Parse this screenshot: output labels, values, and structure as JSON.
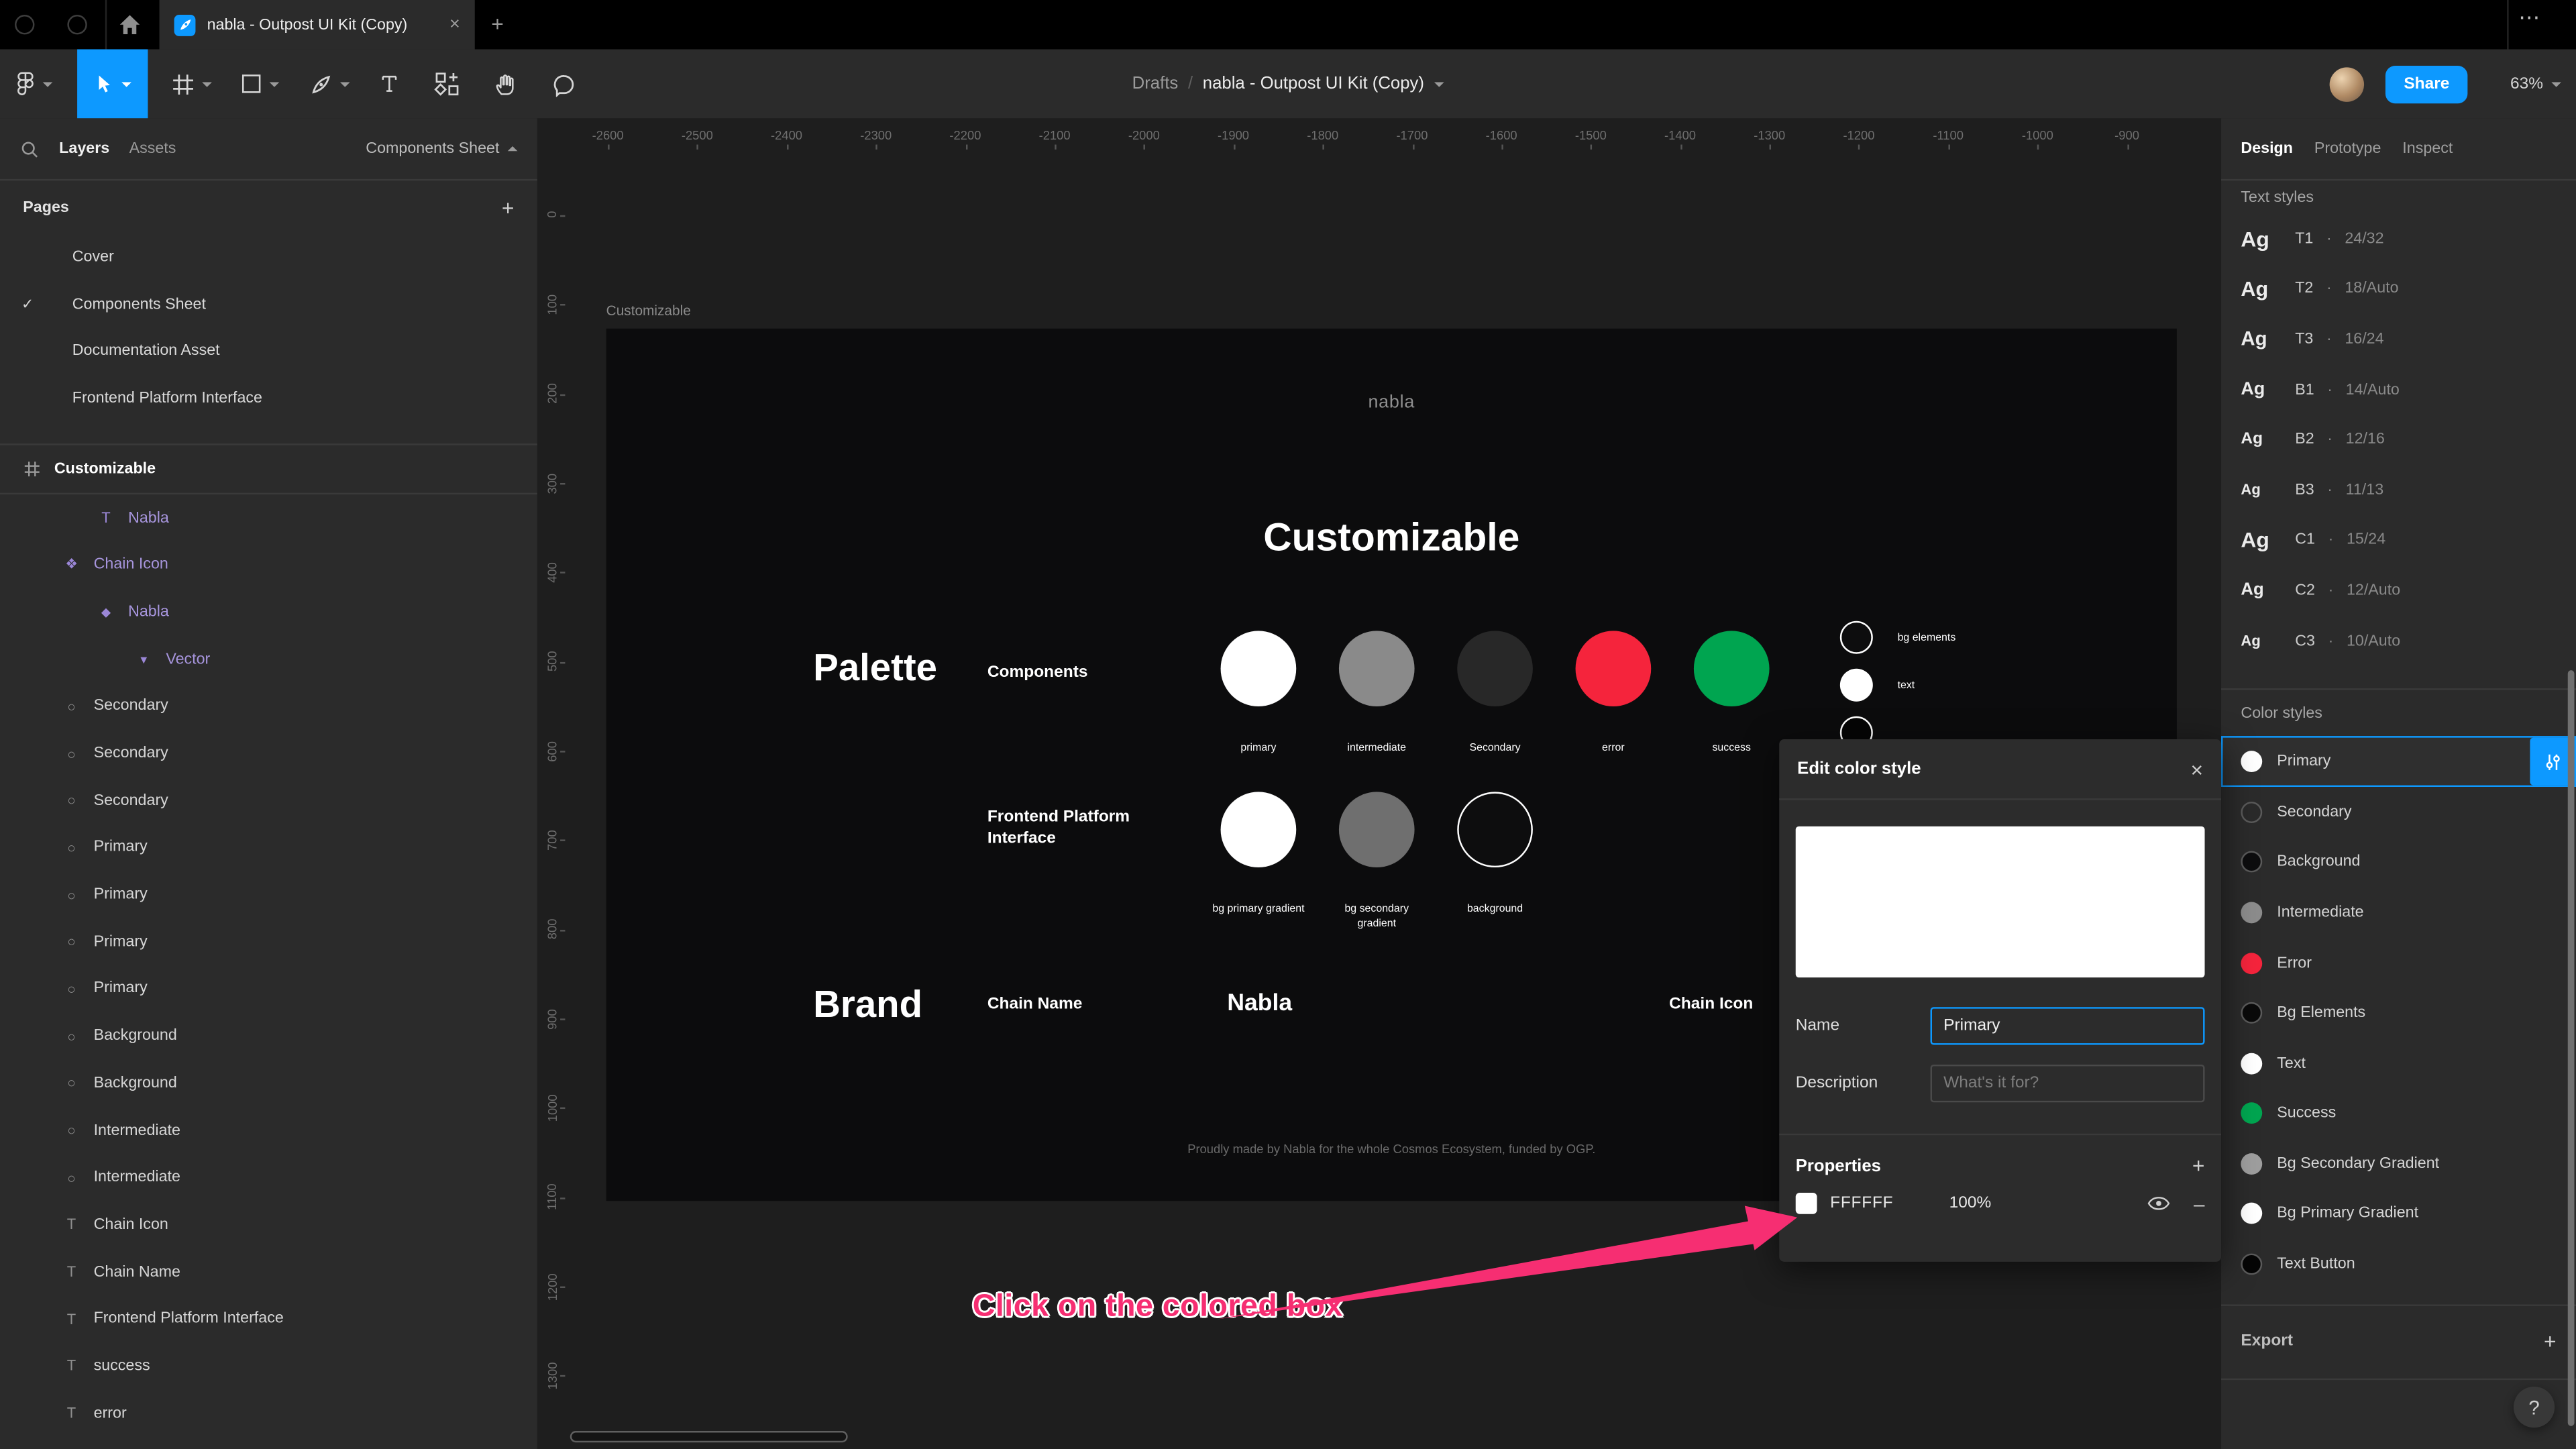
{
  "icons": {
    "close": "×",
    "plus": "+",
    "minus": "–",
    "check": "✓",
    "more": "⋯",
    "middot": "·",
    "help": "?",
    "newtab": "+"
  },
  "topbar": {
    "tab_title": "nabla - Outpost UI Kit (Copy)"
  },
  "toolbar": {
    "breadcrumb_root": "Drafts",
    "breadcrumb_sep": "/",
    "file_name": "nabla - Outpost UI Kit (Copy)",
    "share_label": "Share",
    "zoom_level": "63%"
  },
  "left_sidebar": {
    "layers_tab": "Layers",
    "assets_tab": "Assets",
    "page_selector": "Components Sheet",
    "pages_header": "Pages",
    "pages": [
      {
        "label": "Cover",
        "check": ""
      },
      {
        "label": "Components Sheet",
        "check": "✓"
      },
      {
        "label": "Documentation Asset",
        "check": ""
      },
      {
        "label": "Frontend Platform Interface",
        "check": ""
      }
    ],
    "frame_name": "Customizable",
    "layers": [
      {
        "glyph": "T",
        "label": "Nabla",
        "tone": "purple",
        "pad": "57px",
        "gsize": "9px"
      },
      {
        "glyph": "❖",
        "label": "Chain Icon",
        "tone": "purple",
        "pad": "36px",
        "gsize": "8.5px"
      },
      {
        "glyph": "◆",
        "label": "Nabla",
        "tone": "purple",
        "pad": "57px",
        "gsize": "7.5px"
      },
      {
        "glyph": "▾",
        "label": "Vector",
        "tone": "purple",
        "pad": "80px",
        "gsize": "8px"
      },
      {
        "glyph": "○",
        "label": "Secondary",
        "tone": "",
        "pad": "36px",
        "gsize": "8.5px"
      },
      {
        "glyph": "○",
        "label": "Secondary",
        "tone": "",
        "pad": "36px",
        "gsize": "8.5px"
      },
      {
        "glyph": "○",
        "label": "Secondary",
        "tone": "",
        "pad": "36px",
        "gsize": "8.5px"
      },
      {
        "glyph": "○",
        "label": "Primary",
        "tone": "",
        "pad": "36px",
        "gsize": "8.5px"
      },
      {
        "glyph": "○",
        "label": "Primary",
        "tone": "",
        "pad": "36px",
        "gsize": "8.5px"
      },
      {
        "glyph": "○",
        "label": "Primary",
        "tone": "",
        "pad": "36px",
        "gsize": "8.5px"
      },
      {
        "glyph": "○",
        "label": "Primary",
        "tone": "",
        "pad": "36px",
        "gsize": "8.5px"
      },
      {
        "glyph": "○",
        "label": "Background",
        "tone": "",
        "pad": "36px",
        "gsize": "8.5px"
      },
      {
        "glyph": "○",
        "label": "Background",
        "tone": "",
        "pad": "36px",
        "gsize": "8.5px"
      },
      {
        "glyph": "○",
        "label": "Intermediate",
        "tone": "",
        "pad": "36px",
        "gsize": "8.5px"
      },
      {
        "glyph": "○",
        "label": "Intermediate",
        "tone": "",
        "pad": "36px",
        "gsize": "8.5px"
      },
      {
        "glyph": "T",
        "label": "Chain Icon",
        "tone": "",
        "pad": "36px",
        "gsize": "9px"
      },
      {
        "glyph": "T",
        "label": "Chain Name",
        "tone": "",
        "pad": "36px",
        "gsize": "9px"
      },
      {
        "glyph": "T",
        "label": "Frontend Platform Interface",
        "tone": "",
        "pad": "36px",
        "gsize": "9px"
      },
      {
        "glyph": "T",
        "label": "success",
        "tone": "",
        "pad": "36px",
        "gsize": "9px"
      },
      {
        "glyph": "T",
        "label": "error",
        "tone": "",
        "pad": "36px",
        "gsize": "9px"
      }
    ]
  },
  "canvas": {
    "frame_label": "Customizable",
    "logo": "nabla",
    "title": "Customizable",
    "h_ruler": [
      "-2600",
      "-2500",
      "-2400",
      "-2300",
      "-2200",
      "-2100",
      "-2000",
      "-1900",
      "-1800",
      "-1700",
      "-1600",
      "-1500",
      "-1400",
      "-1300",
      "-1200",
      "-1100",
      "-1000",
      "-900"
    ],
    "v_ruler": [
      "0",
      "100",
      "200",
      "300",
      "400",
      "500",
      "600",
      "700",
      "800",
      "900",
      "1000",
      "1100",
      "1200",
      "1300"
    ],
    "palette": {
      "title": "Palette",
      "subtitle": "Components",
      "swatches": [
        {
          "label": "primary",
          "color": "#FFFFFF",
          "cls": ""
        },
        {
          "label": "intermediate",
          "color": "#8A8A8A",
          "cls": ""
        },
        {
          "label": "Secondary",
          "color": "#282828",
          "cls": ""
        },
        {
          "label": "error",
          "color": "#F5243C",
          "cls": ""
        },
        {
          "label": "success",
          "color": "#00A550",
          "cls": ""
        }
      ]
    },
    "side_swatches": [
      {
        "label": "bg elements",
        "color": "#0D0D0E",
        "cls": "wring"
      },
      {
        "label": "text",
        "color": "#FFFFFF",
        "cls": ""
      },
      {
        "label": "",
        "color": "#050505",
        "cls": "wring"
      }
    ],
    "fpi": {
      "title": "Frontend Platform Interface",
      "swatches": [
        {
          "label": "bg primary gradient",
          "color": "#FFFFFF",
          "cls": ""
        },
        {
          "label": "bg secondary gradient",
          "color": "#6F6F6F",
          "cls": ""
        },
        {
          "label": "background",
          "color": "#0D0D0E",
          "cls": "wring"
        }
      ]
    },
    "brand": {
      "title": "Brand",
      "name_label": "Chain Name",
      "name_value": "Nabla",
      "icon_label": "Chain Icon"
    },
    "footer": "Proudly made by Nabla for the whole Cosmos Ecosystem, funded by OGP."
  },
  "dialog": {
    "title": "Edit color style",
    "name_label": "Name",
    "name_value": "Primary",
    "description_label": "Description",
    "description_placeholder": "What's it for?",
    "properties_label": "Properties",
    "hex": "FFFFFF",
    "opacity": "100%"
  },
  "annotation": {
    "text": "Click on the colored box",
    "color": "#F62E72"
  },
  "right_sidebar": {
    "tabs": [
      {
        "label": "Design",
        "cls": "active"
      },
      {
        "label": "Prototype",
        "cls": ""
      },
      {
        "label": "Inspect",
        "cls": ""
      }
    ],
    "text_styles_header": "Text styles",
    "sample": "Ag",
    "text_styles": [
      {
        "name": "T1",
        "value": "24/32",
        "size": "13px",
        "weight": "700"
      },
      {
        "name": "T2",
        "value": "18/Auto",
        "size": "12.5px",
        "weight": "700"
      },
      {
        "name": "T3",
        "value": "16/24",
        "size": "12px",
        "weight": "700"
      },
      {
        "name": "B1",
        "value": "14/Auto",
        "size": "11px",
        "weight": "700"
      },
      {
        "name": "B2",
        "value": "12/16",
        "size": "10px",
        "weight": "700"
      },
      {
        "name": "B3",
        "value": "11/13",
        "size": "9px",
        "weight": "700"
      },
      {
        "name": "C1",
        "value": "15/24",
        "size": "13px",
        "weight": "700"
      },
      {
        "name": "C2",
        "value": "12/Auto",
        "size": "10.5px",
        "weight": "700"
      },
      {
        "name": "C3",
        "value": "10/Auto",
        "size": "9px",
        "weight": "700"
      }
    ],
    "color_styles_header": "Color styles",
    "color_styles": [
      {
        "name": "Primary",
        "color": "#FFFFFF",
        "cls": "",
        "row": "selected"
      },
      {
        "name": "Secondary",
        "color": "#2A2A2A",
        "cls": "ring",
        "row": ""
      },
      {
        "name": "Background",
        "color": "#0D0D0E",
        "cls": "ring",
        "row": ""
      },
      {
        "name": "Intermediate",
        "color": "#8C8C8C",
        "cls": "",
        "row": ""
      },
      {
        "name": "Error",
        "color": "#F5243C",
        "cls": "",
        "row": ""
      },
      {
        "name": "Bg Elements",
        "color": "#0A0A0A",
        "cls": "ring",
        "row": ""
      },
      {
        "name": "Text",
        "color": "#FFFFFF",
        "cls": "",
        "row": ""
      },
      {
        "name": "Success",
        "color": "#00A550",
        "cls": "",
        "row": ""
      },
      {
        "name": "Bg Secondary Gradient",
        "color": "#9E9E9E",
        "cls": "",
        "row": ""
      },
      {
        "name": "Bg Primary Gradient",
        "color": "#FFFFFF",
        "cls": "",
        "row": ""
      },
      {
        "name": "Text Button",
        "color": "#050505",
        "cls": "ring",
        "row": ""
      }
    ],
    "export_header": "Export"
  }
}
